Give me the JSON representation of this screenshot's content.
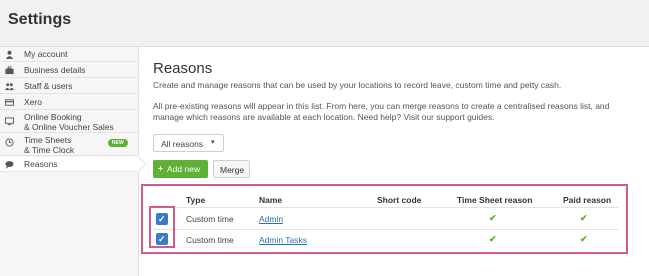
{
  "header": {
    "title": "Settings"
  },
  "sidebar": {
    "items": [
      {
        "label": "My account",
        "icon": "user-icon"
      },
      {
        "label": "Business details",
        "icon": "briefcase-icon"
      },
      {
        "label": "Staff & users",
        "icon": "users-icon"
      },
      {
        "label": "Xero",
        "icon": "card-icon"
      },
      {
        "label": "Online Booking",
        "label2": "& Online Voucher Sales",
        "icon": "monitor-icon"
      },
      {
        "label": "Time Sheets",
        "label2": "& Time Clock",
        "icon": "clock-icon",
        "badge": "NEW"
      },
      {
        "label": "Reasons",
        "icon": "speech-bubble-icon",
        "active": true
      }
    ]
  },
  "main": {
    "title": "Reasons",
    "description1": "Create and manage reasons that can be used by your locations to record leave, custom time and petty cash.",
    "description2_line1": "All pre-existing reasons will appear in this list. From here, you can merge reasons to create a centralised reasons list, and",
    "description2_line2": "manage which reasons are available at each location. Need help? Visit our support guides.",
    "filter": {
      "selected": "All reasons",
      "caret": "▾"
    },
    "add_button": {
      "plus": "+",
      "label": "Add new"
    },
    "merge_button": {
      "label": "Merge"
    }
  },
  "table": {
    "headers": {
      "type": "Type",
      "name": "Name",
      "short_code": "Short code",
      "time_sheet": "Time Sheet reason",
      "paid": "Paid reason"
    },
    "rows": [
      {
        "checked": true,
        "type": "Custom time",
        "name": "Admin",
        "short_code": "",
        "time_sheet": "✔",
        "paid": "✔"
      },
      {
        "checked": true,
        "type": "Custom time",
        "name": "Admin Tasks",
        "short_code": "",
        "time_sheet": "✔",
        "paid": "✔"
      }
    ]
  },
  "colors": {
    "accent_green": "#5fb135",
    "checkbox_blue": "#3a7bc8",
    "highlight_pink": "#d35a8e"
  }
}
